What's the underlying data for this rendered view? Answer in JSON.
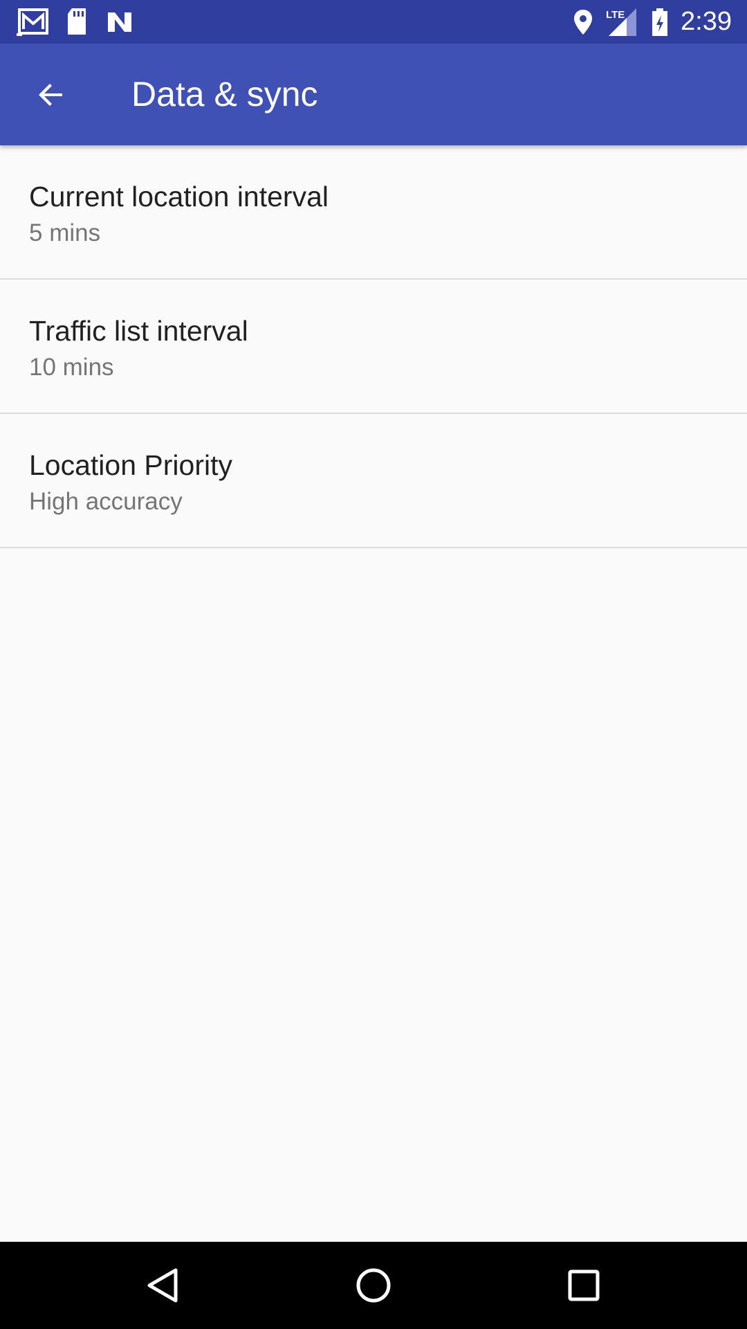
{
  "status_bar": {
    "time": "2:39",
    "network_type": "LTE",
    "icons": [
      "gmail-icon",
      "sd-card-icon",
      "n-icon",
      "location-icon",
      "signal-icon",
      "battery-icon"
    ]
  },
  "app_bar": {
    "title": "Data & sync",
    "background_color": "#3f51b5",
    "status_bar_color": "#303f9f"
  },
  "preferences": [
    {
      "title": "Current location interval",
      "summary": "5 mins"
    },
    {
      "title": "Traffic list interval",
      "summary": "10 mins"
    },
    {
      "title": "Location Priority",
      "summary": "High accuracy"
    }
  ],
  "nav_bar": {
    "buttons": [
      "back-nav-icon",
      "home-nav-icon",
      "recents-nav-icon"
    ]
  }
}
